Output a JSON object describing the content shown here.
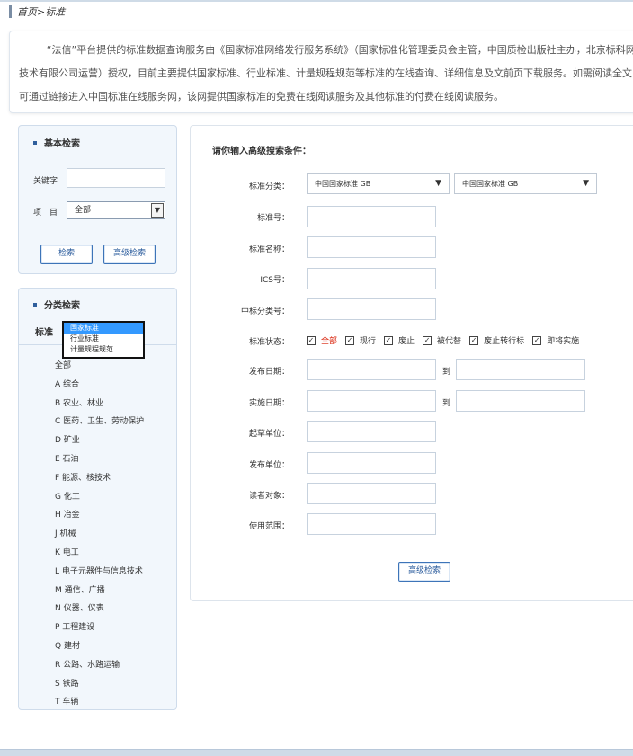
{
  "breadcrumb": {
    "home": "首页",
    "sep": ">",
    "current": "标准"
  },
  "intro": {
    "text": "“法信”平台提供的标准数据查询服务由《国家标准网络发行服务系统》（国家标准化管理委员会主管，中国质检出版社主办，北京标科网络技术有限公司运营）授权，目前主要提供国家标准、行业标准、计量规程规范等标准的在线查询、详细信息及文前页下载服务。如需阅读全文，可通过链接进入中国标准在线服务网，该网提供国家标准的免费在线阅读服务及其他标准的付费在线阅读服务。"
  },
  "basic_search": {
    "title": "基本检索",
    "keyword_label": "关键字",
    "item_label": "项　目",
    "item_value": "全部",
    "search_label": "检索",
    "advanced_label": "高级检索"
  },
  "category_search": {
    "title": "分类检索",
    "standard_label": "标准",
    "dropdown_options": [
      "国家标准",
      "行业标准",
      "计量规程规范"
    ],
    "categories": [
      "全部",
      "A 综合",
      "B 农业、林业",
      "C 医药、卫生、劳动保护",
      "D 矿业",
      "E 石油",
      "F 能源、核技术",
      "G 化工",
      "H 冶金",
      "J 机械",
      "K 电工",
      "L 电子元器件与信息技术",
      "M 通信、广播",
      "N 仪器、仪表",
      "P 工程建设",
      "Q 建材",
      "R 公路、水路运输",
      "S 铁路",
      "T 车辆"
    ]
  },
  "advanced_search": {
    "title": "请你输入高级搜索条件：",
    "category_label": "标准分类：",
    "category_value_1": "中国国家标准 GB",
    "category_value_2": "中国国家标准 GB",
    "number_label": "标准号：",
    "name_label": "标准名称：",
    "ics_label": "ICS号：",
    "ccs_label": "中标分类号：",
    "status_label": "标准状态：",
    "status_options": [
      "全部",
      "现行",
      "废止",
      "被代替",
      "废止转行标",
      "即将实施"
    ],
    "publish_date_label": "发布日期：",
    "implement_date_label": "实施日期：",
    "to_label": "到",
    "drafter_label": "起草单位：",
    "publisher_label": "发布单位：",
    "audience_label": "读者对象：",
    "scope_label": "使用范围：",
    "submit_label": "高级检索"
  }
}
